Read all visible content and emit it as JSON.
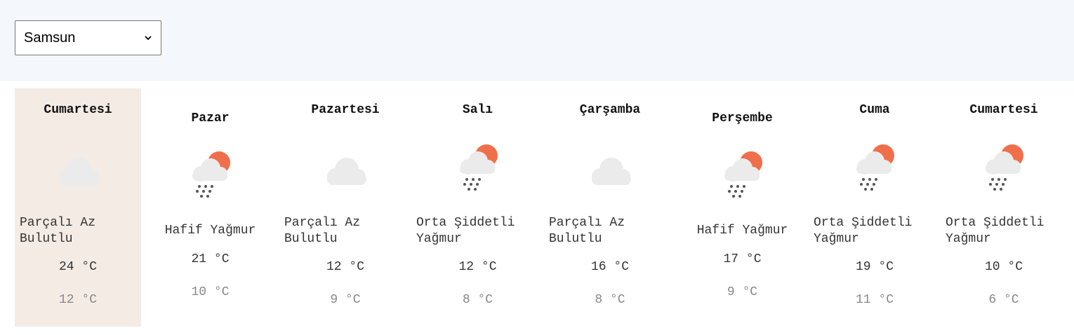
{
  "city_select": {
    "value": "Samsun"
  },
  "days": [
    {
      "name": "Cumartesi",
      "icon": "cloud-icon",
      "desc": "Parçalı Az Bulutlu",
      "high": "24 °C",
      "low": "12 °C"
    },
    {
      "name": "Pazar",
      "icon": "sun-cloud-rain-icon",
      "desc": "Hafif Yağmur",
      "high": "21 °C",
      "low": "10 °C"
    },
    {
      "name": "Pazartesi",
      "icon": "cloud-icon",
      "desc": "Parçalı Az Bulutlu",
      "high": "12 °C",
      "low": "9 °C"
    },
    {
      "name": "Salı",
      "icon": "sun-cloud-rain-icon",
      "desc": "Orta Şiddetli Yağmur",
      "high": "12 °C",
      "low": "8 °C"
    },
    {
      "name": "Çarşamba",
      "icon": "cloud-icon",
      "desc": "Parçalı Az Bulutlu",
      "high": "16 °C",
      "low": "8 °C"
    },
    {
      "name": "Perşembe",
      "icon": "sun-cloud-rain-icon",
      "desc": "Hafif Yağmur",
      "high": "17 °C",
      "low": "9 °C"
    },
    {
      "name": "Cuma",
      "icon": "sun-cloud-rain-icon",
      "desc": "Orta Şiddetli Yağmur",
      "high": "19 °C",
      "low": "11 °C"
    },
    {
      "name": "Cumartesi",
      "icon": "sun-cloud-rain-icon",
      "desc": "Orta Şiddetli Yağmur",
      "high": "10 °C",
      "low": "6 °C"
    }
  ],
  "colors": {
    "active_bg": "#f3ebe4",
    "sun": "#ef6f4b",
    "cloud": "#ebebeb",
    "rain": "#555555",
    "topbar": "#f4f7fb"
  }
}
